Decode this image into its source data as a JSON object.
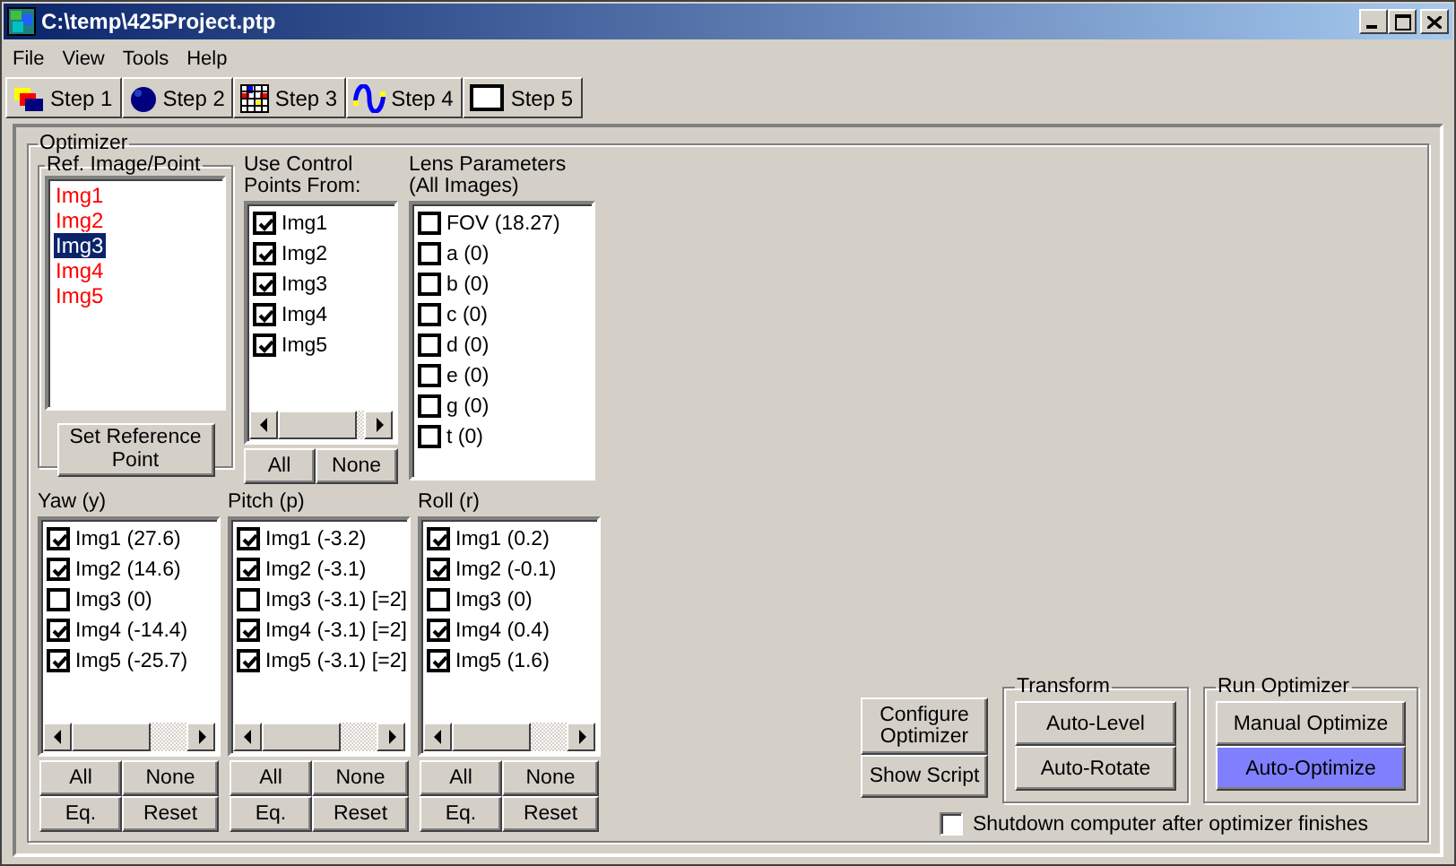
{
  "window": {
    "title": "C:\\temp\\425Project.ptp"
  },
  "menu": [
    "File",
    "View",
    "Tools",
    "Help"
  ],
  "steps": [
    "Step 1",
    "Step 2",
    "Step 3",
    "Step 4",
    "Step 5"
  ],
  "optimizer": {
    "title": "Optimizer",
    "reference": {
      "title": "Ref. Image/Point",
      "items": [
        {
          "label": "Img1",
          "selected": false
        },
        {
          "label": "Img2",
          "selected": false
        },
        {
          "label": "Img3",
          "selected": true
        },
        {
          "label": "Img4",
          "selected": false
        },
        {
          "label": "Img5",
          "selected": false
        }
      ],
      "button": "Set Reference Point"
    },
    "control_points": {
      "title": "Use Control Points From:",
      "items": [
        {
          "label": "Img1",
          "checked": true
        },
        {
          "label": "Img2",
          "checked": true
        },
        {
          "label": "Img3",
          "checked": true
        },
        {
          "label": "Img4",
          "checked": true
        },
        {
          "label": "Img5",
          "checked": true
        }
      ],
      "buttons": [
        "All",
        "None"
      ]
    },
    "lens": {
      "title": "Lens Parameters (All Images)",
      "items": [
        {
          "label": "FOV (18.27)",
          "checked": false
        },
        {
          "label": "a (0)",
          "checked": false
        },
        {
          "label": "b (0)",
          "checked": false
        },
        {
          "label": "c (0)",
          "checked": false
        },
        {
          "label": "d (0)",
          "checked": false
        },
        {
          "label": "e (0)",
          "checked": false
        },
        {
          "label": "g (0)",
          "checked": false
        },
        {
          "label": "t (0)",
          "checked": false
        }
      ]
    },
    "angles": [
      {
        "title": "Yaw (y)",
        "items": [
          {
            "label": "Img1 (27.6)",
            "checked": true
          },
          {
            "label": "Img2 (14.6)",
            "checked": true
          },
          {
            "label": "Img3 (0)",
            "checked": false
          },
          {
            "label": "Img4 (-14.4)",
            "checked": true
          },
          {
            "label": "Img5 (-25.7)",
            "checked": true
          }
        ],
        "buttons": [
          "All",
          "None",
          "Eq.",
          "Reset"
        ]
      },
      {
        "title": "Pitch (p)",
        "items": [
          {
            "label": "Img1 (-3.2)",
            "checked": true
          },
          {
            "label": "Img2 (-3.1)",
            "checked": true
          },
          {
            "label": "Img3 (-3.1) [=2]",
            "checked": false
          },
          {
            "label": "Img4 (-3.1) [=2]",
            "checked": true
          },
          {
            "label": "Img5 (-3.1) [=2]",
            "checked": true
          }
        ],
        "buttons": [
          "All",
          "None",
          "Eq.",
          "Reset"
        ]
      },
      {
        "title": "Roll (r)",
        "items": [
          {
            "label": "Img1 (0.2)",
            "checked": true
          },
          {
            "label": "Img2 (-0.1)",
            "checked": true
          },
          {
            "label": "Img3 (0)",
            "checked": false
          },
          {
            "label": "Img4 (0.4)",
            "checked": true
          },
          {
            "label": "Img5 (1.6)",
            "checked": true
          }
        ],
        "buttons": [
          "All",
          "None",
          "Eq.",
          "Reset"
        ]
      }
    ],
    "config_buttons": [
      "Configure Optimizer",
      "Show Script"
    ],
    "transform": {
      "title": "Transform",
      "buttons": [
        {
          "label": "Auto-Level",
          "selected": false
        },
        {
          "label": "Auto-Rotate",
          "selected": false
        }
      ]
    },
    "run": {
      "title": "Run Optimizer",
      "buttons": [
        {
          "label": "Manual Optimize",
          "selected": false
        },
        {
          "label": "Auto-Optimize",
          "selected": true
        }
      ]
    },
    "shutdown": {
      "label": "Shutdown computer after optimizer finishes",
      "checked": false
    }
  }
}
